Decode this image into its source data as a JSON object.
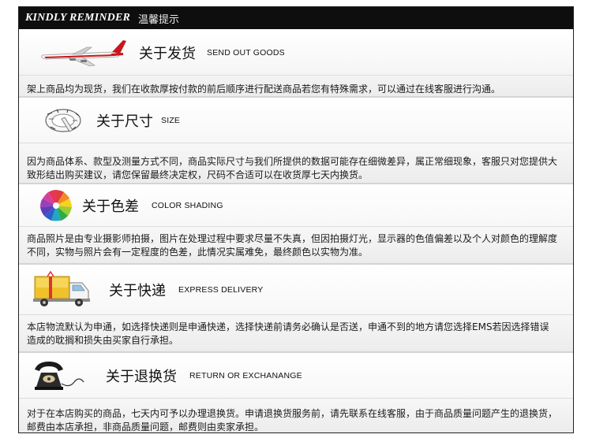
{
  "header": {
    "brand": "KINDLY REMINDER",
    "subtitle": "温馨提示"
  },
  "sections": [
    {
      "icon": "airplane-icon",
      "title_cn": "关于发货",
      "title_en": "SEND  OUT  GOODS",
      "text": "架上商品均为现货，我们在收款厚按付款的前后顺序进行配送商品若您有特殊需求，可以通过在线客服进行沟通。"
    },
    {
      "icon": "measuring-tape-icon",
      "title_cn": "关于尺寸",
      "title_en": "SIZE",
      "text": "因为商品体系、款型及测量方式不同，商品实际尺寸与我们所提供的数据可能存在细微差异，属正常细现象，客服只对您提供大致形结出购买建议，请您保留最终决定权，尺码不合适可以在收货厚七天内换货。"
    },
    {
      "icon": "color-wheel-icon",
      "title_cn": "关于色差",
      "title_en": "COLOR SHADING",
      "text": "商品照片是由专业摄影师拍摄，图片在处理过程中要求尽量不失真，但因拍摄灯光，显示器的色值偏差以及个人对颜色的理解度不同，实物与照片会有一定程度的色差，此情况实属难免，最终颜色以实物为准。"
    },
    {
      "icon": "delivery-truck-icon",
      "title_cn": "关于快递",
      "title_en": "EXPRESS DELIVERY",
      "text": "本店物流默认为申通，如选择快递则是申通快递，选择快递前请务必确认是否送，申通不到的地方请您选择EMS若因选择错误造成的耽搁和损失由买家自行承担。"
    },
    {
      "icon": "telephone-icon",
      "title_cn": "关于退换货",
      "title_en": "RETURN OR EXCHANANGE",
      "text": "对于在本店购买的商品，七天内可予以办理退换货。申请退换货服务前，请先联系在线客服，由于商品质量问题产生的退换货，邮费由本店承担，非商品质量问题，邮费则由卖家承担。"
    }
  ]
}
